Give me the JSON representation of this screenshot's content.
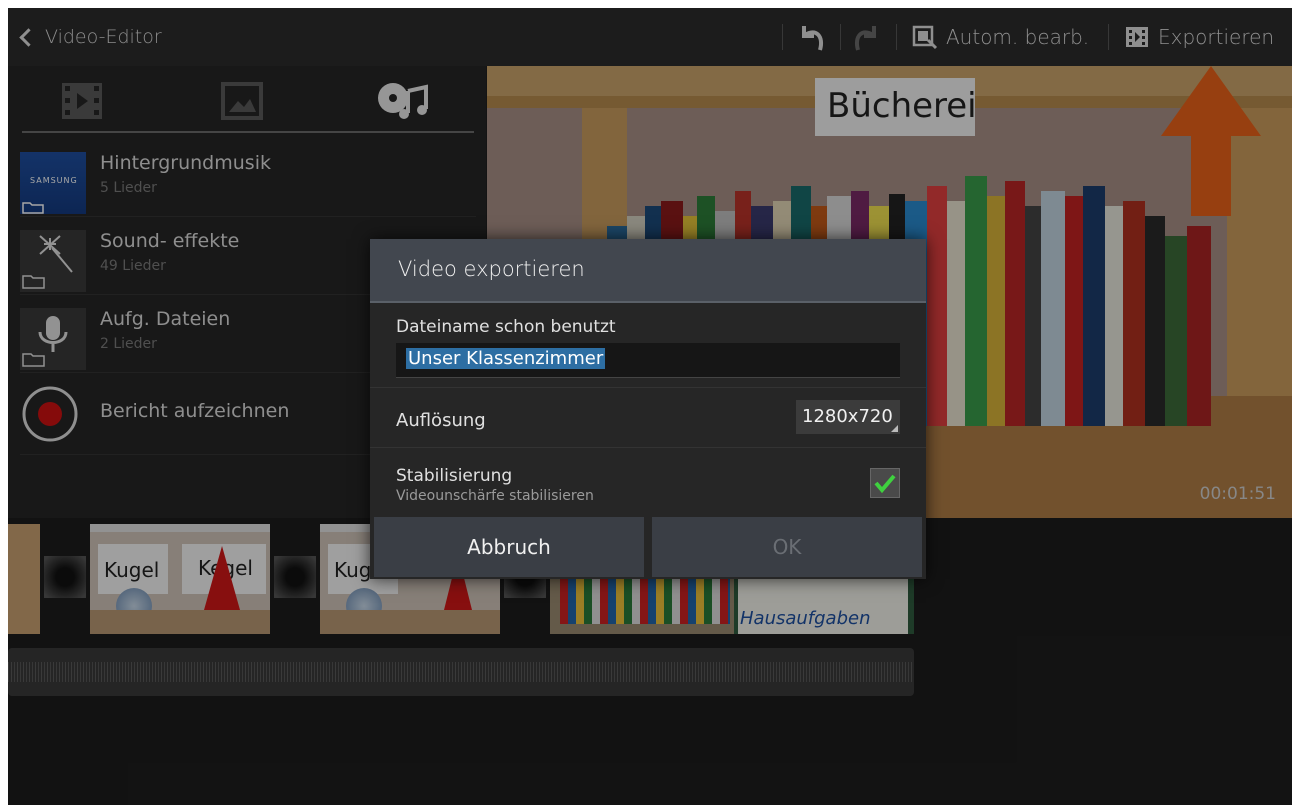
{
  "actionbar": {
    "title": "Video-Editor",
    "auto_edit_label": "Autom. bearb.",
    "export_label": "Exportieren",
    "icons": [
      "back-chevron-icon",
      "undo-icon",
      "redo-icon",
      "auto-edit-icon",
      "export-icon"
    ]
  },
  "sidebar": {
    "tabs": [
      "film-icon",
      "image-icon",
      "music-icon"
    ],
    "items": [
      {
        "title": "Hintergrundmusik",
        "subtitle": "5 Lieder",
        "thumb_text": "SAMSUNG"
      },
      {
        "title": "Sound- effekte",
        "subtitle": "49 Lieder"
      },
      {
        "title": "Aufg. Dateien",
        "subtitle": "2 Lieder"
      },
      {
        "title": "Bericht aufzeichnen"
      }
    ]
  },
  "preview": {
    "sign_text": "Bücherei",
    "timecode": "00:01:51"
  },
  "timeline": {
    "clips": [
      {
        "caption_left": "Kugel",
        "caption_right": "Kegel"
      },
      {
        "caption_left": "Kug"
      },
      {
        "caption": "Hausaufgaben"
      }
    ]
  },
  "dialog": {
    "title": "Video exportieren",
    "filename_label": "Dateiname schon benutzt",
    "filename_value": "Unser Klassenzimmer",
    "resolution_label": "Auflösung",
    "resolution_value": "1280x720",
    "stabilize_label": "Stabilisierung",
    "stabilize_sub": "Videounschärfe stabilisieren",
    "stabilize_checked": true,
    "cancel_label": "Abbruch",
    "ok_label": "OK"
  },
  "colors": {
    "accent_arrow": "#e8621a",
    "record_red": "#cc1111",
    "checkbox_green": "#3fd13f",
    "selection_blue": "#2d6ea3"
  }
}
